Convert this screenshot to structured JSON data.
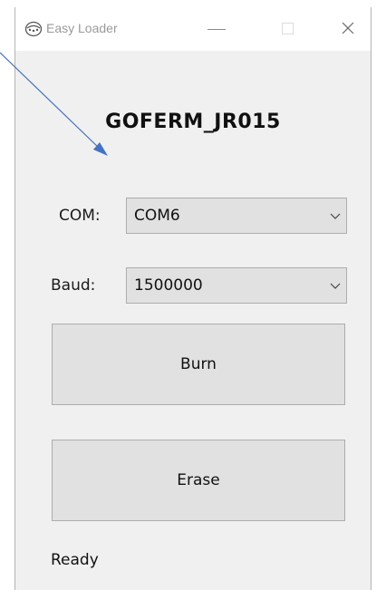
{
  "window": {
    "title": "Easy Loader",
    "icon": "app-icon",
    "controls": {
      "minimize": "minimize-icon",
      "maximize": "maximize-icon",
      "close": "close-icon"
    }
  },
  "main": {
    "heading": "GOFERM_JR015",
    "com": {
      "label": "COM:",
      "value": "COM6"
    },
    "baud": {
      "label": "Baud:",
      "value": "1500000"
    },
    "burn_label": "Burn",
    "erase_label": "Erase",
    "status": "Ready"
  },
  "colors": {
    "window_bg": "#f0f0f0",
    "control_bg": "#e1e1e1",
    "control_border": "#adadad",
    "annotation_arrow": "#4472c4"
  }
}
